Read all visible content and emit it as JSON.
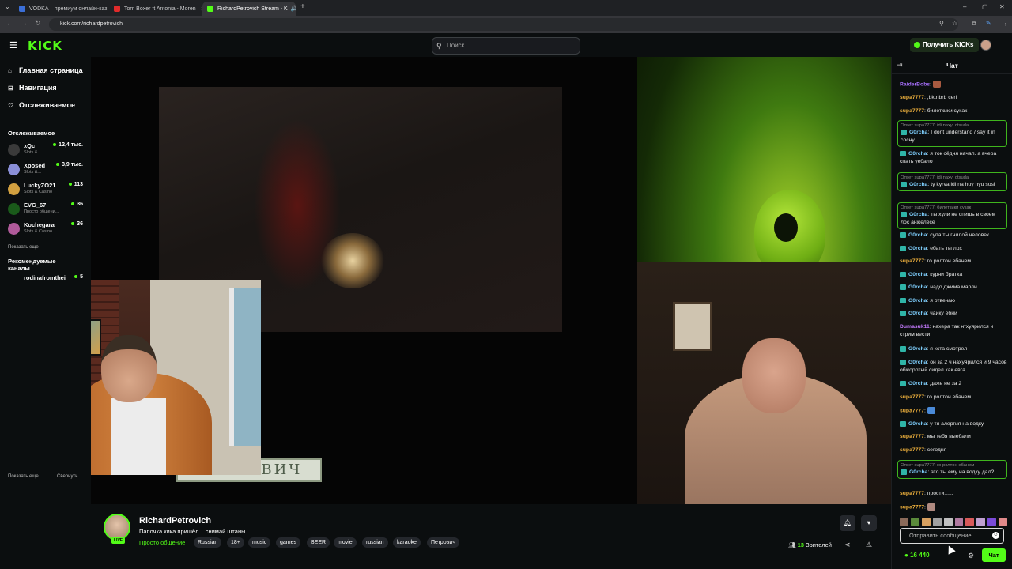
{
  "browser": {
    "tabs": [
      {
        "title": "VODKA – премиум онлайн-каз",
        "color": "#3b6fd8"
      },
      {
        "title": "Tom Boxer ft Antonia - Moren",
        "color": "#e02b2b"
      },
      {
        "title": "RichardPetrovich Stream - K",
        "color": "#53fc18"
      }
    ],
    "url": "kick.com/richardpetrovich"
  },
  "header": {
    "logo": "KICK",
    "search_placeholder": "Поиск",
    "get_kicks": "Получить KICKs"
  },
  "sidebar": {
    "nav": [
      {
        "label": "Главная страница",
        "icon": "home-icon"
      },
      {
        "label": "Навигация",
        "icon": "compass-icon"
      },
      {
        "label": "Отслеживаемое",
        "icon": "heart-icon"
      }
    ],
    "following_title": "Отслеживаемое",
    "following": [
      {
        "name": "xQc",
        "category": "Slots &...",
        "viewers": "12,4 тыс.",
        "color": "#3a3a3a"
      },
      {
        "name": "Xposed",
        "category": "Slots &...",
        "viewers": "3,9 тыс.",
        "color": "#8a8fd8"
      },
      {
        "name": "LuckyZO21",
        "category": "Slots & Casino",
        "viewers": "113",
        "color": "#d2a040"
      },
      {
        "name": "EVG_67",
        "category": "Просто общени...",
        "viewers": "36",
        "color": "#1a5a1a"
      },
      {
        "name": "Kochegara",
        "category": "Slots & Casino",
        "viewers": "36",
        "color": "#b05a9a"
      }
    ],
    "show_more": "Показать еще",
    "recommended_title": "Рекомендуемые каналы",
    "recommended": [
      {
        "name": "rodinafromthei",
        "viewers": "5"
      }
    ],
    "show_more_2": "Показать еще",
    "collapse": "Свернуть"
  },
  "video": {
    "nameplate": "ПЕТРОВИЧ"
  },
  "stream": {
    "streamer": "RichardPetrovich",
    "live_badge": "LIVE",
    "title": "Папочка кика пришёл... снимай штаны",
    "category": "Просто общение",
    "tags": [
      "Russian",
      "18+",
      "music",
      "games",
      "BEER",
      "movie",
      "russian",
      "karaoke",
      "Петрович"
    ],
    "viewers_count": "13",
    "viewers_label": "Зрителей"
  },
  "chat": {
    "title": "Чат",
    "messages": [
      {
        "user": "RaiderBobs",
        "color": "#a970ff",
        "text": ":",
        "emote": "#a85a40",
        "reply": "",
        "badge": false
      },
      {
        "user": "supa7777",
        "color": "#f2b33d",
        "text": ": ,bktnbrb cerf",
        "reply": "",
        "badge": false
      },
      {
        "user": "supa7777",
        "color": "#f2b33d",
        "text": ": билеткики сукак",
        "reply": "",
        "badge": false
      },
      {
        "user": "G0rcha",
        "color": "#7fd0ff",
        "text": ": I dont understand / say it in соcну",
        "reply": "Ответ supa7777: idi naxyi otsuda",
        "badge": true
      },
      {
        "user": "G0rcha",
        "color": "#7fd0ff",
        "text": ": я ток сёдня начал. а вчера спать уебало",
        "reply": "",
        "badge": true
      },
      {
        "user": "G0rcha",
        "color": "#7fd0ff",
        "text": ": ty kyrva idi na huy hyu sosi",
        "reply": "Ответ supa7777: idi naxyi otsuda",
        "badge": true
      },
      {
        "user": "G0rcha",
        "color": "#7fd0ff",
        "text": ": ты хули не спишь в своем лос анжелесе",
        "reply": "Ответ supa7777: билеткики сукак",
        "badge": true
      },
      {
        "user": "G0rcha",
        "color": "#7fd0ff",
        "text": ": супа ты гнилой человек",
        "reply": "",
        "badge": true
      },
      {
        "user": "G0rcha",
        "color": "#7fd0ff",
        "text": ": ебать ты лох",
        "reply": "",
        "badge": true
      },
      {
        "user": "supa7777",
        "color": "#f2b33d",
        "text": ": го ролтон ебанем",
        "reply": "",
        "badge": false
      },
      {
        "user": "G0rcha",
        "color": "#7fd0ff",
        "text": ": курни братка",
        "reply": "",
        "badge": true
      },
      {
        "user": "G0rcha",
        "color": "#7fd0ff",
        "text": ": надо джима марли",
        "reply": "",
        "badge": true
      },
      {
        "user": "G0rcha",
        "color": "#7fd0ff",
        "text": ": я отвечаю",
        "reply": "",
        "badge": true
      },
      {
        "user": "G0rcha",
        "color": "#7fd0ff",
        "text": ": чайку ебни",
        "reply": "",
        "badge": true
      },
      {
        "user": "Dumasuk11",
        "color": "#c57bff",
        "text": ": нахера так н*хуярился и стрим вести",
        "reply": "",
        "badge": false
      },
      {
        "user": "G0rcha",
        "color": "#7fd0ff",
        "text": ": я кста смотрел",
        "reply": "",
        "badge": true
      },
      {
        "user": "G0rcha",
        "color": "#7fd0ff",
        "text": ": он за 2 ч нахуярился и 9 часов обжоротый сидел как евга",
        "reply": "",
        "badge": true
      },
      {
        "user": "G0rcha",
        "color": "#7fd0ff",
        "text": ": даже не за 2",
        "reply": "",
        "badge": true
      },
      {
        "user": "supa7777",
        "color": "#f2b33d",
        "text": ": го ролтон ебанем",
        "reply": "",
        "badge": false
      },
      {
        "user": "supa7777",
        "color": "#f2b33d",
        "text": ":",
        "emote": "#4a8ad8",
        "reply": "",
        "badge": false
      },
      {
        "user": "G0rcha",
        "color": "#7fd0ff",
        "text": ": у тя алергия на водку",
        "reply": "",
        "badge": true
      },
      {
        "user": "supa7777",
        "color": "#f2b33d",
        "text": ": мы тебя выебали",
        "reply": "",
        "badge": false
      },
      {
        "user": "supa7777",
        "color": "#f2b33d",
        "text": ": сегодня",
        "reply": "",
        "badge": false
      },
      {
        "user": "G0rcha",
        "color": "#7fd0ff",
        "text": ": это ты ему на водку дал?",
        "reply": "Ответ supa7777: го ролтон ебанем",
        "badge": true
      },
      {
        "user": "supa7777",
        "color": "#f2b33d",
        "text": ": прости......",
        "reply": "",
        "badge": false
      },
      {
        "user": "supa7777",
        "color": "#f2b33d",
        "text": ":",
        "emote": "#b08a80",
        "reply": "",
        "badge": false
      }
    ],
    "emotes": [
      "#8a6a5a",
      "#5a8a3a",
      "#d8a060",
      "#a0a0a0",
      "#c0c0c0",
      "#b07aa0",
      "#d85a5a",
      "#c0a0d0",
      "#7a4ad8",
      "#e08a8a"
    ],
    "input_placeholder": "Отправить сообщение",
    "balance": "16 440",
    "send_label": "Чат"
  },
  "colors": {
    "brand": "#53fc18",
    "background": "#0b0e0f"
  }
}
